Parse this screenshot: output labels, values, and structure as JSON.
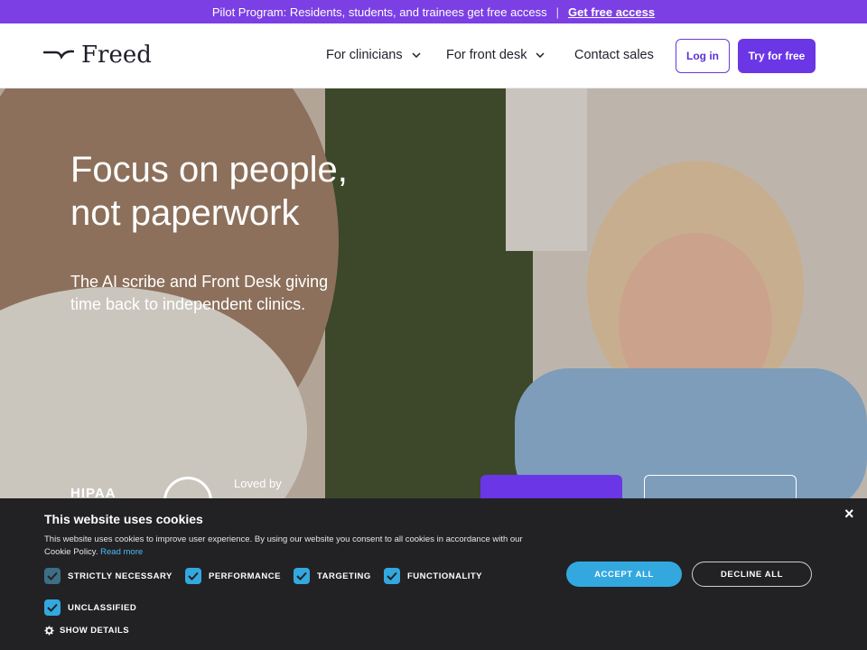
{
  "announcement": {
    "text": "Pilot Program: Residents, students, and trainees get free access",
    "separator": "|",
    "link": "Get free access"
  },
  "nav": {
    "brand": "Freed",
    "items": [
      {
        "label": "For clinicians"
      },
      {
        "label": "For front desk"
      },
      {
        "label": "Contact sales"
      }
    ],
    "login": "Log in",
    "try": "Try for free"
  },
  "hero": {
    "title_line1": "Focus on people,",
    "title_line2": "not paperwork",
    "subtitle_line1": "The AI scribe and Front Desk giving",
    "subtitle_line2": "time back to independent clinics.",
    "badge_hipaa": "HIPAA",
    "badge_loved": "Loved by"
  },
  "cookie": {
    "title": "This website uses cookies",
    "text": "This website uses cookies to improve user experience. By using our website you consent to all cookies in accordance with our Cookie Policy.",
    "read_more": "Read more",
    "close": "×",
    "options": [
      {
        "label": "STRICTLY NECESSARY",
        "checked": true
      },
      {
        "label": "PERFORMANCE",
        "checked": true
      },
      {
        "label": "TARGETING",
        "checked": true
      },
      {
        "label": "FUNCTIONALITY",
        "checked": true
      },
      {
        "label": "UNCLASSIFIED",
        "checked": true
      }
    ],
    "accept": "ACCEPT ALL",
    "decline": "DECLINE ALL",
    "show_details": "SHOW DETAILS"
  },
  "colors": {
    "brand_purple": "#6b36e6",
    "cookie_accent": "#33a8df",
    "cookie_bg": "#222225"
  }
}
